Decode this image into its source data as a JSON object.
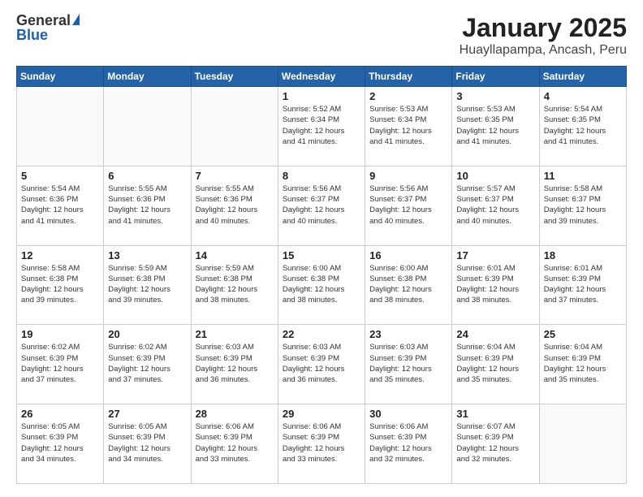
{
  "header": {
    "logo_general": "General",
    "logo_blue": "Blue",
    "title": "January 2025",
    "subtitle": "Huayllapampa, Ancash, Peru"
  },
  "days_of_week": [
    "Sunday",
    "Monday",
    "Tuesday",
    "Wednesday",
    "Thursday",
    "Friday",
    "Saturday"
  ],
  "weeks": [
    [
      {
        "day": "",
        "info": ""
      },
      {
        "day": "",
        "info": ""
      },
      {
        "day": "",
        "info": ""
      },
      {
        "day": "1",
        "info": "Sunrise: 5:52 AM\nSunset: 6:34 PM\nDaylight: 12 hours\nand 41 minutes."
      },
      {
        "day": "2",
        "info": "Sunrise: 5:53 AM\nSunset: 6:34 PM\nDaylight: 12 hours\nand 41 minutes."
      },
      {
        "day": "3",
        "info": "Sunrise: 5:53 AM\nSunset: 6:35 PM\nDaylight: 12 hours\nand 41 minutes."
      },
      {
        "day": "4",
        "info": "Sunrise: 5:54 AM\nSunset: 6:35 PM\nDaylight: 12 hours\nand 41 minutes."
      }
    ],
    [
      {
        "day": "5",
        "info": "Sunrise: 5:54 AM\nSunset: 6:36 PM\nDaylight: 12 hours\nand 41 minutes."
      },
      {
        "day": "6",
        "info": "Sunrise: 5:55 AM\nSunset: 6:36 PM\nDaylight: 12 hours\nand 41 minutes."
      },
      {
        "day": "7",
        "info": "Sunrise: 5:55 AM\nSunset: 6:36 PM\nDaylight: 12 hours\nand 40 minutes."
      },
      {
        "day": "8",
        "info": "Sunrise: 5:56 AM\nSunset: 6:37 PM\nDaylight: 12 hours\nand 40 minutes."
      },
      {
        "day": "9",
        "info": "Sunrise: 5:56 AM\nSunset: 6:37 PM\nDaylight: 12 hours\nand 40 minutes."
      },
      {
        "day": "10",
        "info": "Sunrise: 5:57 AM\nSunset: 6:37 PM\nDaylight: 12 hours\nand 40 minutes."
      },
      {
        "day": "11",
        "info": "Sunrise: 5:58 AM\nSunset: 6:37 PM\nDaylight: 12 hours\nand 39 minutes."
      }
    ],
    [
      {
        "day": "12",
        "info": "Sunrise: 5:58 AM\nSunset: 6:38 PM\nDaylight: 12 hours\nand 39 minutes."
      },
      {
        "day": "13",
        "info": "Sunrise: 5:59 AM\nSunset: 6:38 PM\nDaylight: 12 hours\nand 39 minutes."
      },
      {
        "day": "14",
        "info": "Sunrise: 5:59 AM\nSunset: 6:38 PM\nDaylight: 12 hours\nand 38 minutes."
      },
      {
        "day": "15",
        "info": "Sunrise: 6:00 AM\nSunset: 6:38 PM\nDaylight: 12 hours\nand 38 minutes."
      },
      {
        "day": "16",
        "info": "Sunrise: 6:00 AM\nSunset: 6:38 PM\nDaylight: 12 hours\nand 38 minutes."
      },
      {
        "day": "17",
        "info": "Sunrise: 6:01 AM\nSunset: 6:39 PM\nDaylight: 12 hours\nand 38 minutes."
      },
      {
        "day": "18",
        "info": "Sunrise: 6:01 AM\nSunset: 6:39 PM\nDaylight: 12 hours\nand 37 minutes."
      }
    ],
    [
      {
        "day": "19",
        "info": "Sunrise: 6:02 AM\nSunset: 6:39 PM\nDaylight: 12 hours\nand 37 minutes."
      },
      {
        "day": "20",
        "info": "Sunrise: 6:02 AM\nSunset: 6:39 PM\nDaylight: 12 hours\nand 37 minutes."
      },
      {
        "day": "21",
        "info": "Sunrise: 6:03 AM\nSunset: 6:39 PM\nDaylight: 12 hours\nand 36 minutes."
      },
      {
        "day": "22",
        "info": "Sunrise: 6:03 AM\nSunset: 6:39 PM\nDaylight: 12 hours\nand 36 minutes."
      },
      {
        "day": "23",
        "info": "Sunrise: 6:03 AM\nSunset: 6:39 PM\nDaylight: 12 hours\nand 35 minutes."
      },
      {
        "day": "24",
        "info": "Sunrise: 6:04 AM\nSunset: 6:39 PM\nDaylight: 12 hours\nand 35 minutes."
      },
      {
        "day": "25",
        "info": "Sunrise: 6:04 AM\nSunset: 6:39 PM\nDaylight: 12 hours\nand 35 minutes."
      }
    ],
    [
      {
        "day": "26",
        "info": "Sunrise: 6:05 AM\nSunset: 6:39 PM\nDaylight: 12 hours\nand 34 minutes."
      },
      {
        "day": "27",
        "info": "Sunrise: 6:05 AM\nSunset: 6:39 PM\nDaylight: 12 hours\nand 34 minutes."
      },
      {
        "day": "28",
        "info": "Sunrise: 6:06 AM\nSunset: 6:39 PM\nDaylight: 12 hours\nand 33 minutes."
      },
      {
        "day": "29",
        "info": "Sunrise: 6:06 AM\nSunset: 6:39 PM\nDaylight: 12 hours\nand 33 minutes."
      },
      {
        "day": "30",
        "info": "Sunrise: 6:06 AM\nSunset: 6:39 PM\nDaylight: 12 hours\nand 32 minutes."
      },
      {
        "day": "31",
        "info": "Sunrise: 6:07 AM\nSunset: 6:39 PM\nDaylight: 12 hours\nand 32 minutes."
      },
      {
        "day": "",
        "info": ""
      }
    ]
  ]
}
